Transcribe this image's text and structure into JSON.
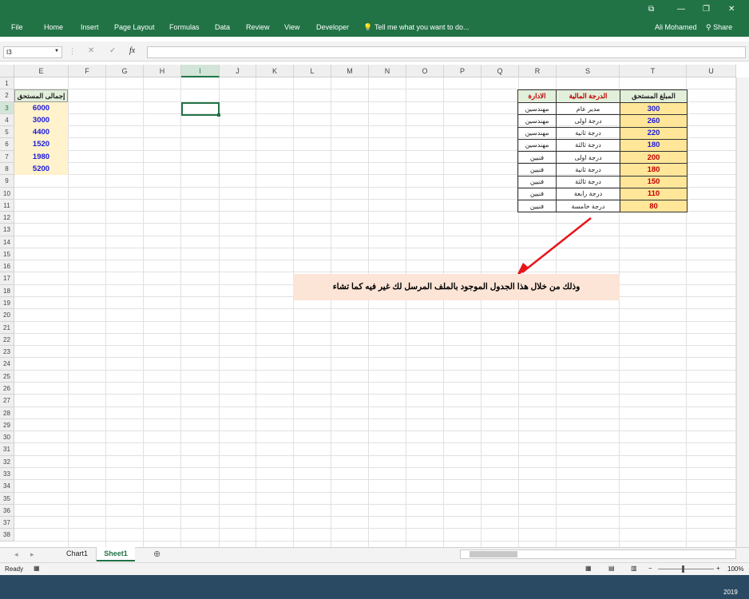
{
  "menu": {
    "tabs": [
      "File",
      "Home",
      "Insert",
      "Page Layout",
      "Formulas",
      "Data",
      "Review",
      "View",
      "Developer"
    ],
    "tell_me": "Tell me what you want to do...",
    "user": "Ali Mohamed",
    "share": "Share"
  },
  "formula_bar": {
    "name_box": "I3",
    "fx": "fx",
    "value": ""
  },
  "columns": [
    "E",
    "F",
    "G",
    "H",
    "I",
    "J",
    "K",
    "L",
    "M",
    "N",
    "O",
    "P",
    "Q",
    "R",
    "S",
    "T",
    "U"
  ],
  "rows": [
    "1",
    "2",
    "3",
    "4",
    "5",
    "6",
    "7",
    "8",
    "9",
    "10",
    "11",
    "12",
    "13",
    "14",
    "15",
    "16",
    "17",
    "18",
    "19",
    "20",
    "21",
    "22",
    "23",
    "24",
    "25",
    "26",
    "27",
    "28",
    "29",
    "30",
    "31",
    "32",
    "33",
    "34",
    "35",
    "36",
    "37",
    "38"
  ],
  "total_column": {
    "header": "إجمالى المستحق",
    "values": [
      "6000",
      "3000",
      "4400",
      "1520",
      "1980",
      "5200"
    ]
  },
  "table": {
    "headers": {
      "dept": "الادارة",
      "grade": "الدرجة المالية",
      "amount": "المبلغ المستحق"
    },
    "rows": [
      {
        "dept": "مهندسين",
        "grade": "مدير عام",
        "amount": "300"
      },
      {
        "dept": "مهندسين",
        "grade": "درجة اولى",
        "amount": "260"
      },
      {
        "dept": "مهندسين",
        "grade": "درجة ثانية",
        "amount": "220"
      },
      {
        "dept": "مهندسين",
        "grade": "درجة ثالثة",
        "amount": "180"
      },
      {
        "dept": "فنيين",
        "grade": "درجة اولى",
        "amount": "200"
      },
      {
        "dept": "فنيين",
        "grade": "درجة ثانية",
        "amount": "180"
      },
      {
        "dept": "فنيين",
        "grade": "درجة ثالثة",
        "amount": "150"
      },
      {
        "dept": "فنيين",
        "grade": "درجة رابعة",
        "amount": "110"
      },
      {
        "dept": "فنيين",
        "grade": "درجة خامسة",
        "amount": "80"
      }
    ]
  },
  "note": "وذلك من خلال هذا الجدول الموجود بالملف المرسل لك  غير فيه كما تشاء",
  "sheets": {
    "tab1": "Chart1",
    "tab2": "Sheet1"
  },
  "status": {
    "ready": "Ready",
    "zoom": "100%"
  },
  "taskbar": {
    "year": "2019"
  },
  "colors": {
    "ribbon": "#217346",
    "amount_blue": "#1a1adb",
    "amount_red": "#c00000",
    "header_fill": "#e2efda"
  }
}
